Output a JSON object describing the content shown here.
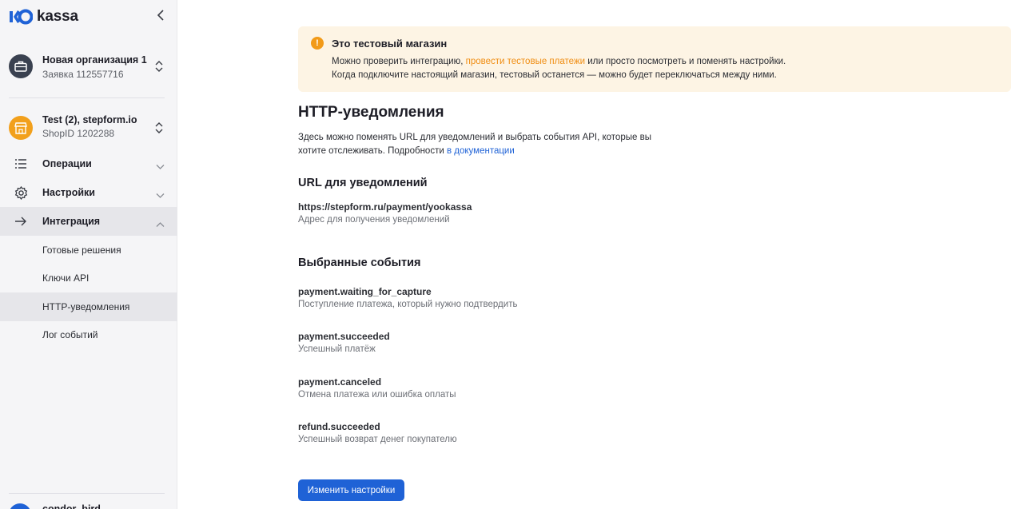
{
  "brand": {
    "logo_text": "kassa",
    "accent": "#1f62d6"
  },
  "sidebar": {
    "org": {
      "title": "Новая организация 1",
      "subtitle": "Заявка 112557716"
    },
    "shop": {
      "title": "Test (2), stepform.io",
      "subtitle": "ShopID 1202288"
    },
    "nav": [
      {
        "label": "Операции",
        "icon": "list-icon"
      },
      {
        "label": "Настройки",
        "icon": "gear-icon"
      },
      {
        "label": "Интеграция",
        "icon": "arrow-right-icon",
        "expanded": true
      }
    ],
    "subnav": [
      {
        "label": "Готовые решения"
      },
      {
        "label": "Ключи API"
      },
      {
        "label": "HTTP-уведомления",
        "active": true
      },
      {
        "label": "Лог событий"
      }
    ],
    "user": {
      "name": "condor_bird"
    }
  },
  "banner": {
    "title": "Это тестовый магазин",
    "line1_before": "Можно проверить интеграцию, ",
    "line1_link": "провести тестовые платежи",
    "line1_after": " или просто посмотреть и поменять настройки.",
    "line2": "Когда подключите настоящий магазин, тестовый останется — можно будет переключаться между ними."
  },
  "page": {
    "title": "HTTP-уведомления",
    "intro_text": "Здесь можно поменять URL для уведомлений и выбрать события API, которые вы хотите отслеживать. Подробности ",
    "intro_link": "в документации"
  },
  "url_section": {
    "title": "URL для уведомлений",
    "value": "https://stepform.ru/payment/yookassa",
    "hint": "Адрес для получения уведомлений"
  },
  "events_section": {
    "title": "Выбранные события",
    "events": [
      {
        "name": "payment.waiting_for_capture",
        "description": "Поступление платежа, который нужно подтвердить"
      },
      {
        "name": "payment.succeeded",
        "description": "Успешный платёж"
      },
      {
        "name": "payment.canceled",
        "description": "Отмена платежа или ошибка оплаты"
      },
      {
        "name": "refund.succeeded",
        "description": "Успешный возврат денег покупателю"
      }
    ]
  },
  "actions": {
    "edit_label": "Изменить настройки"
  }
}
